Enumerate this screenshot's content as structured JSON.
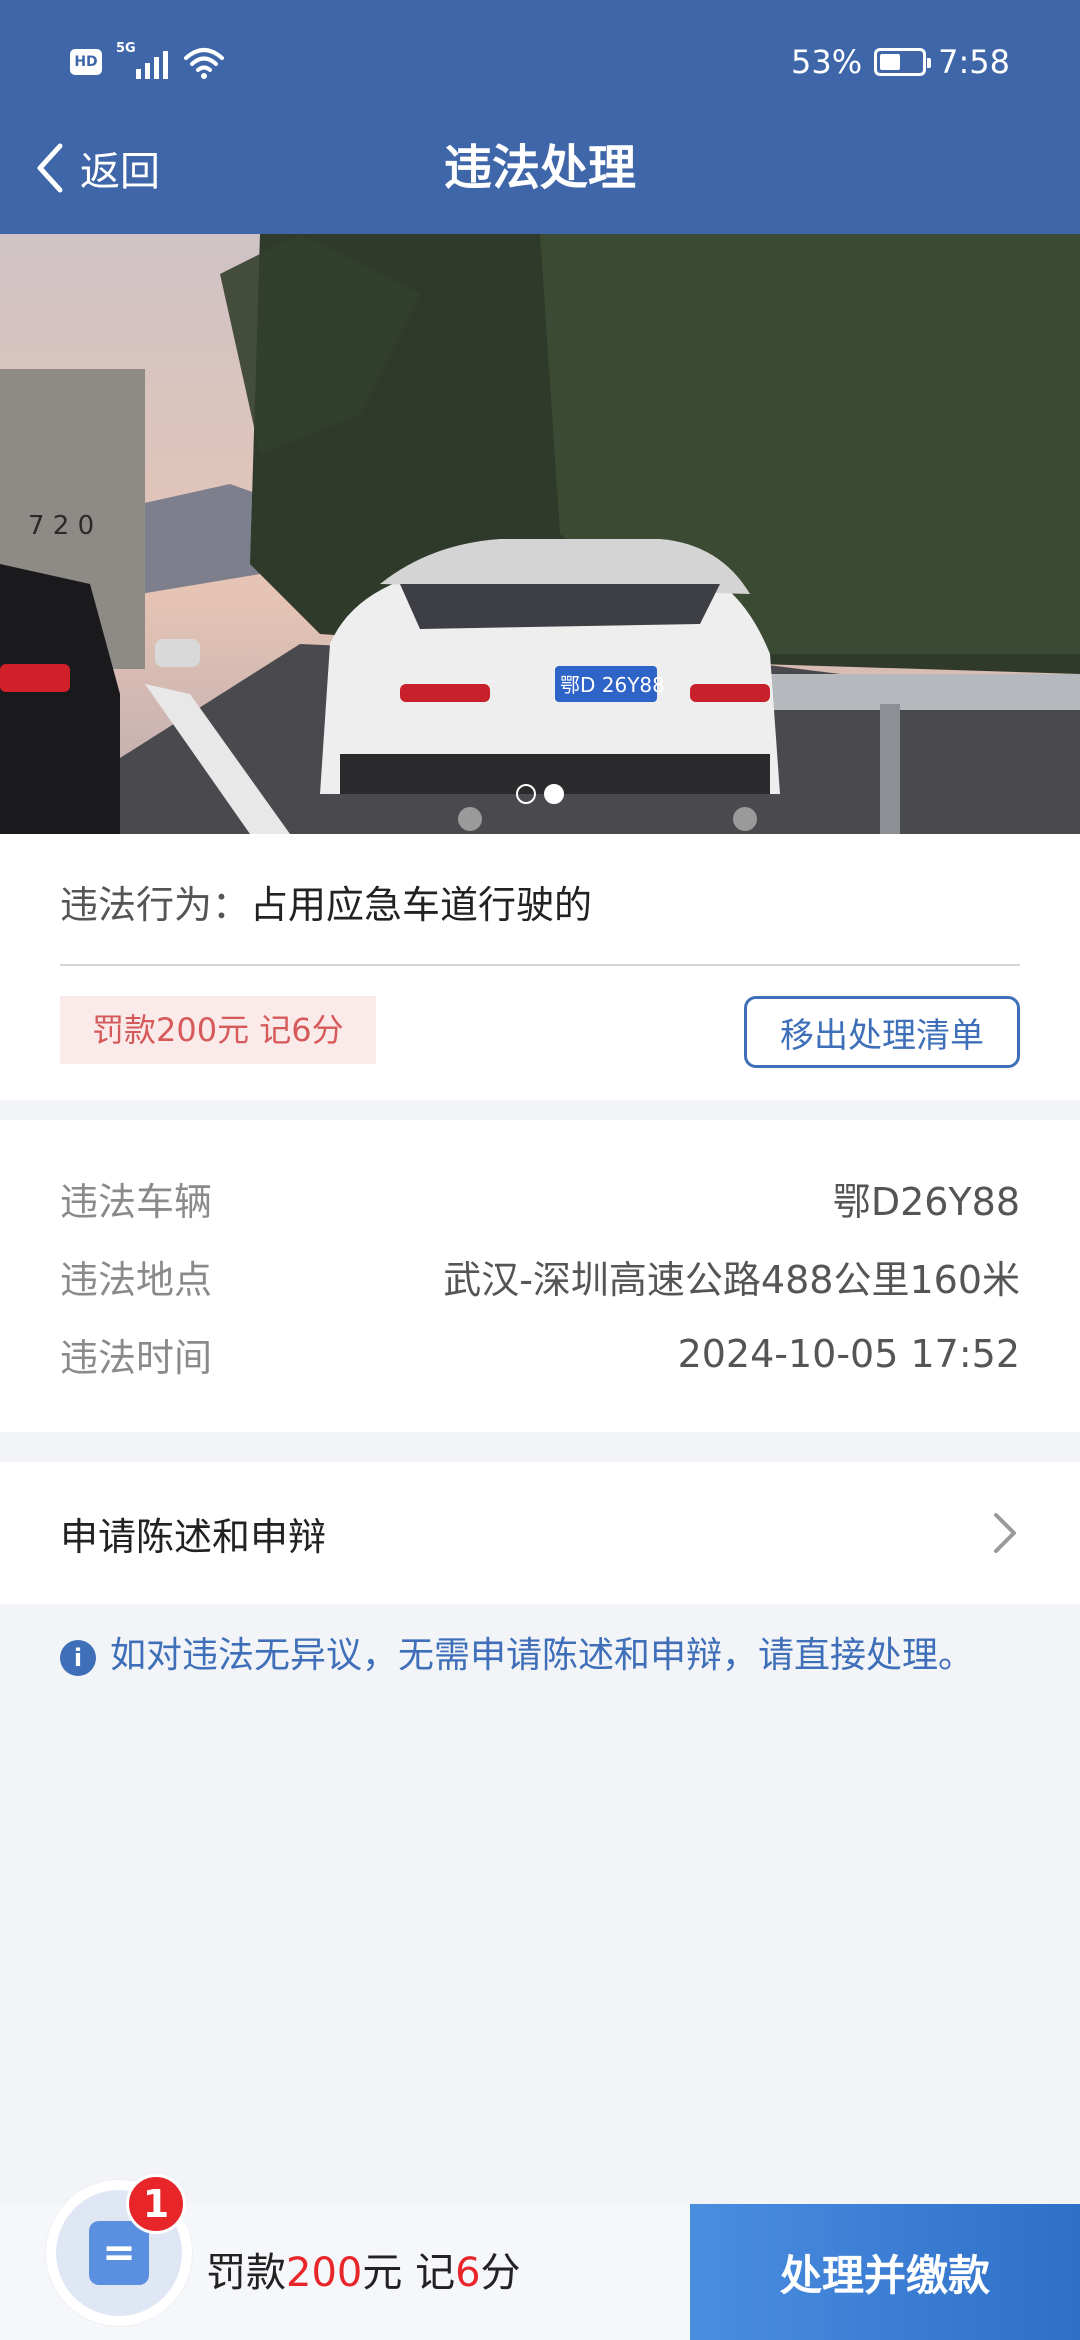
{
  "status_bar": {
    "network_tag": "5G",
    "wifi_tag": "6",
    "hd_label": "HD",
    "battery": "53%",
    "time": "7:58"
  },
  "nav": {
    "back_label": "返回",
    "title": "违法处理"
  },
  "photo": {
    "plate_text": "鄂D 26Y88",
    "truck_number": "7 2 0",
    "carousel_count": 2,
    "carousel_active_index": 1
  },
  "violation": {
    "behavior_key": "违法行为：",
    "behavior_value": "占用应急车道行驶的",
    "penalty_tag": "罚款200元 记6分",
    "remove_button": "移出处理清单"
  },
  "details": [
    {
      "key": "违法车辆",
      "value": "鄂D26Y88"
    },
    {
      "key": "违法地点",
      "value": "武汉-深圳高速公路488公里160米"
    },
    {
      "key": "违法时间",
      "value": "2024-10-05 17:52"
    }
  ],
  "appeal": {
    "label": "申请陈述和申辩"
  },
  "notice": {
    "text": "如对违法无异议，无需申请陈述和申辩，请直接处理。"
  },
  "bottom": {
    "badge_count": "1",
    "summary_prefix": "罚款",
    "fine_amount": "200",
    "summary_mid": "元 记",
    "points": "6",
    "summary_suffix": "分",
    "pay_button": "处理并缴款"
  },
  "colors": {
    "header_bg": "#3e66a8",
    "accent_blue": "#3e6fb8",
    "penalty_red": "#d65a5a",
    "badge_red": "#e8262a"
  }
}
